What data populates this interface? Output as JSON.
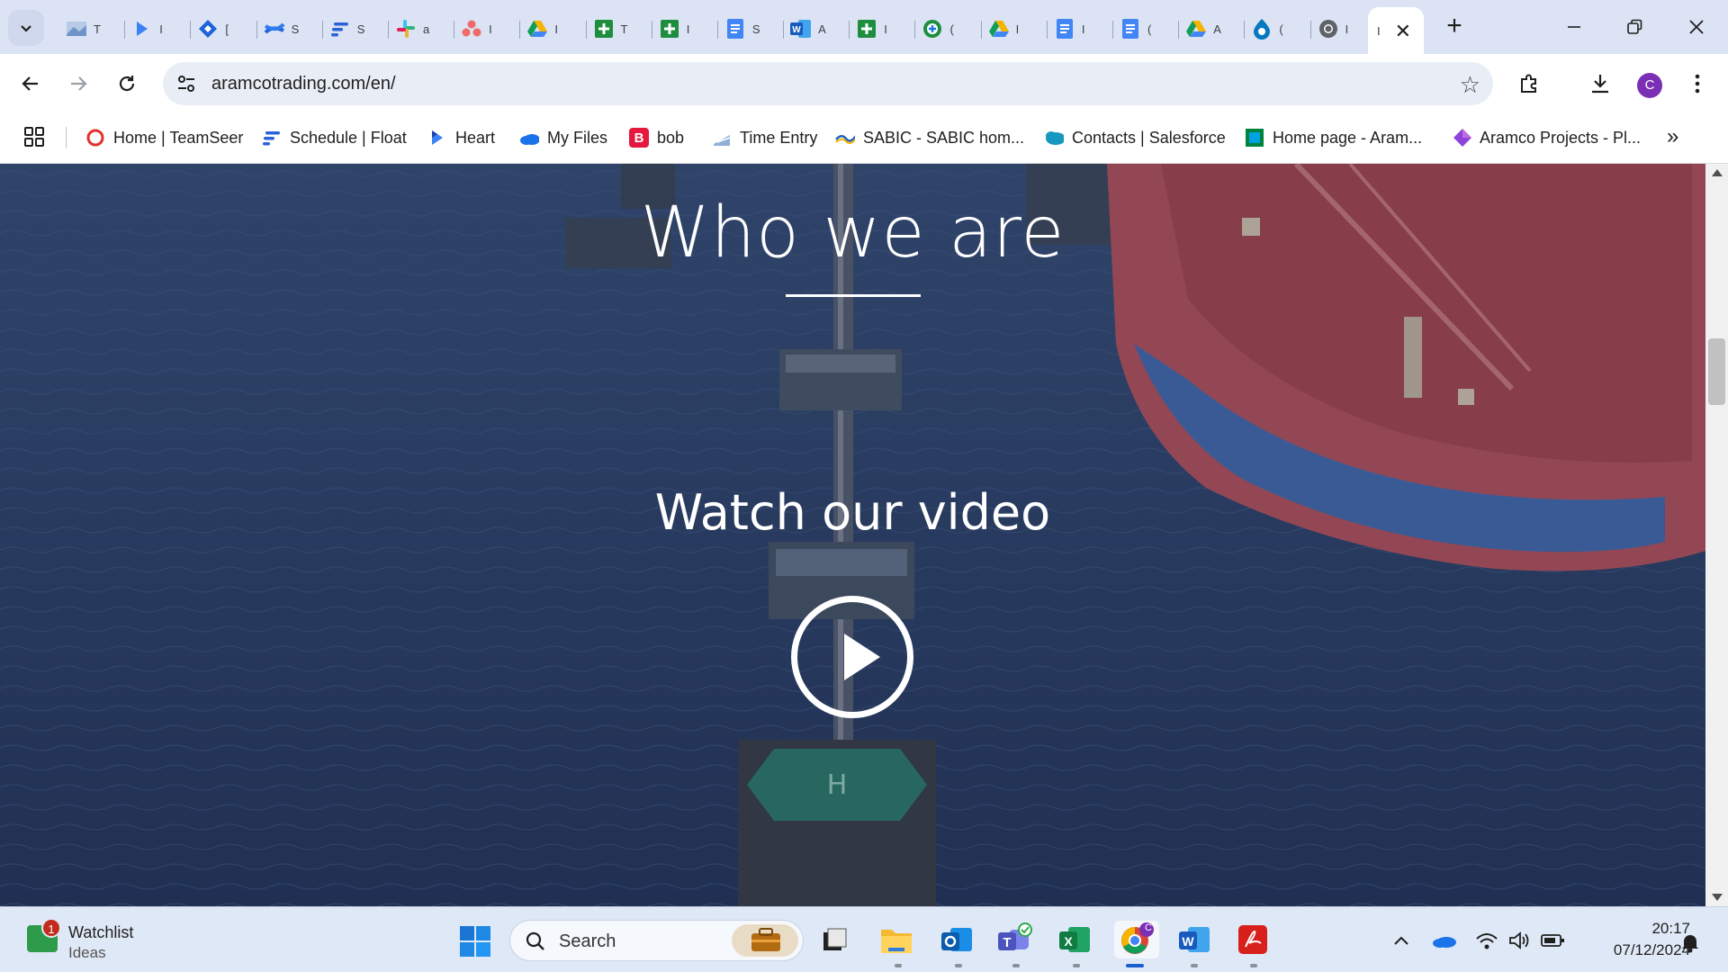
{
  "browser": {
    "tabs": [
      {
        "icon": "image-icon",
        "frag": "T"
      },
      {
        "icon": "heart-app-icon",
        "frag": "I"
      },
      {
        "icon": "jira-icon",
        "frag": "["
      },
      {
        "icon": "confluence-icon",
        "frag": "S"
      },
      {
        "icon": "float-icon",
        "frag": "S"
      },
      {
        "icon": "slack-icon",
        "frag": "a"
      },
      {
        "icon": "asana-icon",
        "frag": "I"
      },
      {
        "icon": "google-drive-icon",
        "frag": "I"
      },
      {
        "icon": "sheets-plus-icon",
        "frag": "T"
      },
      {
        "icon": "sheets-plus-icon",
        "frag": "I"
      },
      {
        "icon": "docs-icon",
        "frag": "S"
      },
      {
        "icon": "word-icon",
        "frag": "A"
      },
      {
        "icon": "sheets-plus-icon",
        "frag": "I"
      },
      {
        "icon": "add-circle-icon",
        "frag": "("
      },
      {
        "icon": "google-drive-icon",
        "frag": "I"
      },
      {
        "icon": "docs-icon",
        "frag": "I"
      },
      {
        "icon": "docs-icon",
        "frag": "("
      },
      {
        "icon": "google-drive-icon",
        "frag": "A"
      },
      {
        "icon": "drupal-icon",
        "frag": "("
      },
      {
        "icon": "chrome-icon",
        "frag": "I"
      }
    ],
    "active_tab": {
      "frag": "I",
      "close": "✕"
    },
    "new_tab": "+",
    "url": "aramcotrading.com/en/",
    "avatar_initial": "C"
  },
  "bookmarks": [
    {
      "label": "Home | TeamSeer",
      "icon": "teamseer-icon"
    },
    {
      "label": "Schedule | Float",
      "icon": "float-icon"
    },
    {
      "label": "Heart",
      "icon": "heart-app-icon"
    },
    {
      "label": "My Files",
      "icon": "onedrive-icon"
    },
    {
      "label": "bob",
      "icon": "bob-icon"
    },
    {
      "label": "Time Entry",
      "icon": "time-entry-icon"
    },
    {
      "label": "SABIC - SABIC hom...",
      "icon": "sabic-icon"
    },
    {
      "label": "Contacts | Salesforce",
      "icon": "salesforce-icon"
    },
    {
      "label": "Home page - Aram...",
      "icon": "aramco-icon"
    },
    {
      "label": "Aramco Projects - Pl...",
      "icon": "planner-icon"
    }
  ],
  "bookmark_letter_bob": "B",
  "page": {
    "heading": "Who we are",
    "video_cta": "Watch our video"
  },
  "taskbar": {
    "widget_title": "Watchlist",
    "widget_sub": "Ideas",
    "widget_badge": "1",
    "search_label": "Search",
    "chrome_badge": "C",
    "time": "20:17",
    "date": "07/12/2024"
  },
  "colors": {
    "tab_strip": "#dbe3f4",
    "sea": "#2f4469",
    "ship_deck": "#b9545b",
    "ship_hull_blue": "#3b6fb8",
    "accent_blue": "#1a5fd0",
    "avatar": "#7b2fb5"
  }
}
